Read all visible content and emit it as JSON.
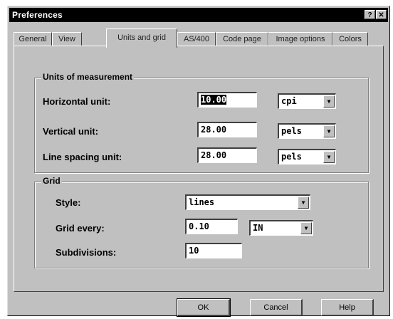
{
  "window": {
    "title": "Preferences",
    "help_glyph": "?",
    "close_glyph": "✕"
  },
  "tabs": [
    {
      "label": "General",
      "active": false
    },
    {
      "label": "View",
      "active": false
    },
    {
      "label": "Units and grid",
      "active": true
    },
    {
      "label": "AS/400",
      "active": false
    },
    {
      "label": "Code page",
      "active": false
    },
    {
      "label": "Image options",
      "active": false
    },
    {
      "label": "Colors",
      "active": false
    }
  ],
  "units": {
    "group_label": "Units of measurement",
    "horizontal_label": "Horizontal unit:",
    "horizontal_value": "10.00",
    "horizontal_unit": "cpi",
    "vertical_label": "Vertical unit:",
    "vertical_value": "28.00",
    "vertical_unit": "pels",
    "spacing_label": "Line spacing unit:",
    "spacing_value": "28.00",
    "spacing_unit": "pels"
  },
  "grid": {
    "group_label": "Grid",
    "style_label": "Style:",
    "style_value": "lines",
    "every_label": "Grid every:",
    "every_value": "0.10",
    "every_unit": "IN",
    "subdiv_label": "Subdivisions:",
    "subdiv_value": "10"
  },
  "buttons": {
    "ok": "OK",
    "cancel": "Cancel",
    "help": "Help"
  },
  "icons": {
    "dropdown": "▼"
  }
}
